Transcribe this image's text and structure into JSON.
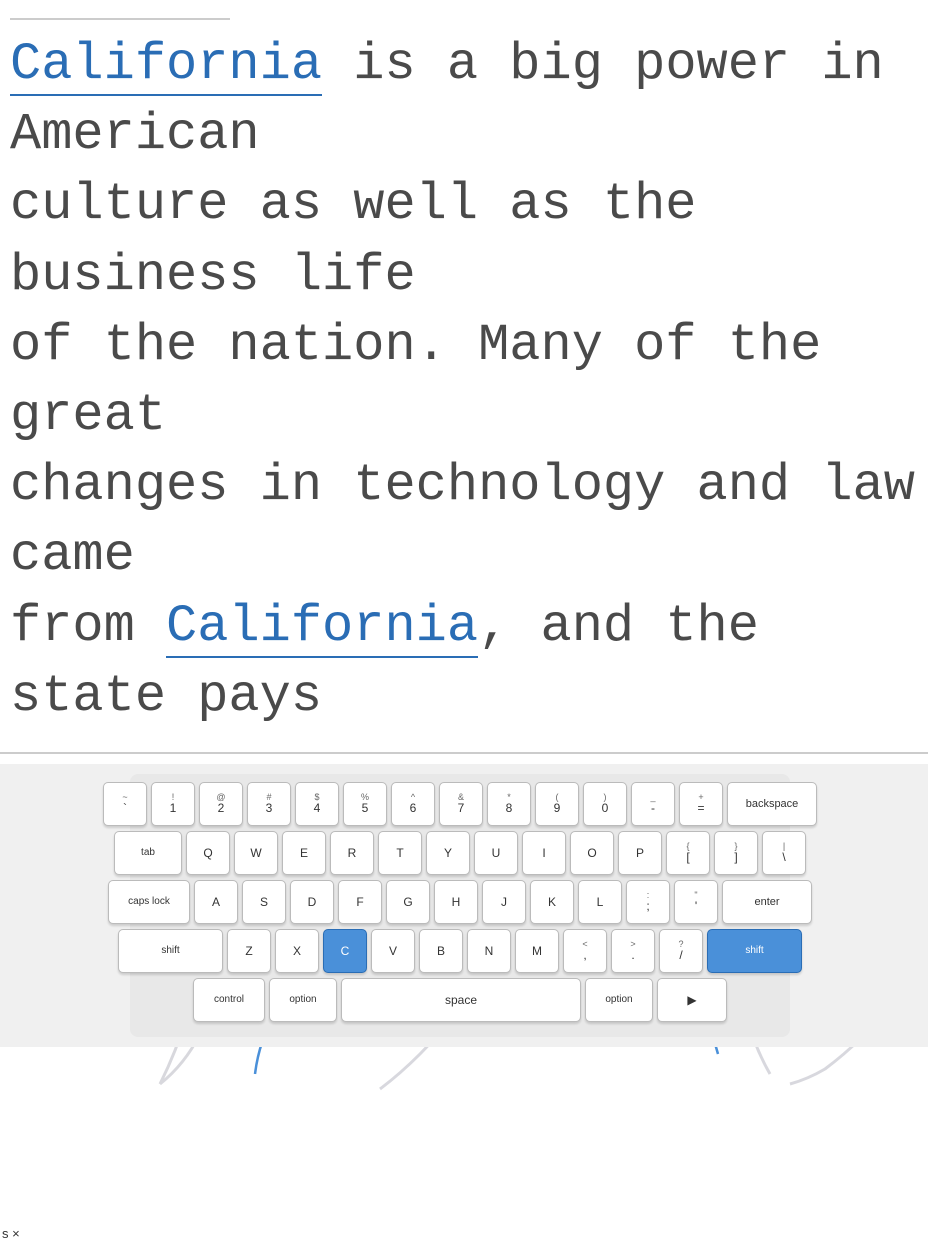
{
  "topLine": {},
  "text": {
    "line1": "California is a big power in American",
    "line2": "culture as well as the business life",
    "line3": "of the nation. Many of the great",
    "line4": "changes in technology and law came",
    "line5": "from California, and the state pays",
    "california_label": "California"
  },
  "sxLabel": "s ×",
  "keyboard": {
    "rows": [
      {
        "id": "number-row",
        "keys": [
          {
            "top": "~",
            "bot": "`"
          },
          {
            "top": "!",
            "bot": "1"
          },
          {
            "top": "@",
            "bot": "2"
          },
          {
            "top": "#",
            "bot": "3"
          },
          {
            "top": "$",
            "bot": "4"
          },
          {
            "top": "%",
            "bot": "5"
          },
          {
            "top": "^",
            "bot": "6"
          },
          {
            "top": "&",
            "bot": "7"
          },
          {
            "top": "*",
            "bot": "8"
          },
          {
            "top": "(",
            "bot": "9"
          },
          {
            "top": ")",
            "bot": "0"
          },
          {
            "top": "_",
            "bot": "-"
          },
          {
            "top": "+",
            "bot": "="
          },
          {
            "top": "",
            "bot": "backspace",
            "wide": "backspace"
          }
        ]
      },
      {
        "id": "qwerty-row",
        "keys": [
          {
            "top": "",
            "bot": "tab",
            "wide": "tab"
          },
          {
            "top": "",
            "bot": "Q"
          },
          {
            "top": "",
            "bot": "W"
          },
          {
            "top": "",
            "bot": "E"
          },
          {
            "top": "",
            "bot": "R"
          },
          {
            "top": "",
            "bot": "T"
          },
          {
            "top": "",
            "bot": "Y"
          },
          {
            "top": "",
            "bot": "U"
          },
          {
            "top": "",
            "bot": "I"
          },
          {
            "top": "",
            "bot": "O"
          },
          {
            "top": "",
            "bot": "P"
          },
          {
            "top": "{",
            "bot": "["
          },
          {
            "top": "}",
            "bot": "]"
          },
          {
            "top": "",
            "bot": "|",
            "wide": "pipe"
          }
        ]
      },
      {
        "id": "asdf-row",
        "keys": [
          {
            "top": "",
            "bot": "caps lock",
            "wide": "caps"
          },
          {
            "top": "",
            "bot": "A"
          },
          {
            "top": "",
            "bot": "S"
          },
          {
            "top": "",
            "bot": "D"
          },
          {
            "top": "",
            "bot": "F"
          },
          {
            "top": "",
            "bot": "G"
          },
          {
            "top": "",
            "bot": "H"
          },
          {
            "top": "",
            "bot": "J"
          },
          {
            "top": "",
            "bot": "K"
          },
          {
            "top": "",
            "bot": "L"
          },
          {
            "top": ":",
            "bot": ";"
          },
          {
            "top": "\"",
            "bot": "'"
          },
          {
            "top": "",
            "bot": "enter",
            "wide": "enter"
          }
        ]
      },
      {
        "id": "zxcv-row",
        "keys": [
          {
            "top": "",
            "bot": "shift",
            "wide": "shift-l"
          },
          {
            "top": "",
            "bot": "Z"
          },
          {
            "top": "",
            "bot": "X"
          },
          {
            "top": "",
            "bot": "C",
            "active": true
          },
          {
            "top": "",
            "bot": "V"
          },
          {
            "top": "",
            "bot": "B"
          },
          {
            "top": "",
            "bot": "N"
          },
          {
            "top": "",
            "bot": "M"
          },
          {
            "top": "<",
            "bot": ","
          },
          {
            "top": ">",
            "bot": "."
          },
          {
            "top": "?",
            "bot": "/"
          },
          {
            "top": "",
            "bot": "shift",
            "wide": "shift-r"
          }
        ]
      },
      {
        "id": "bottom-row",
        "keys": [
          {
            "top": "",
            "bot": "control",
            "wide": "control"
          },
          {
            "top": "",
            "bot": "option",
            "wide": "option"
          },
          {
            "top": "",
            "bot": "space",
            "wide": "space"
          },
          {
            "top": "",
            "bot": "option",
            "wide": "option"
          },
          {
            "top": "",
            "bot": "",
            "wide": "arrow"
          }
        ]
      }
    ]
  }
}
